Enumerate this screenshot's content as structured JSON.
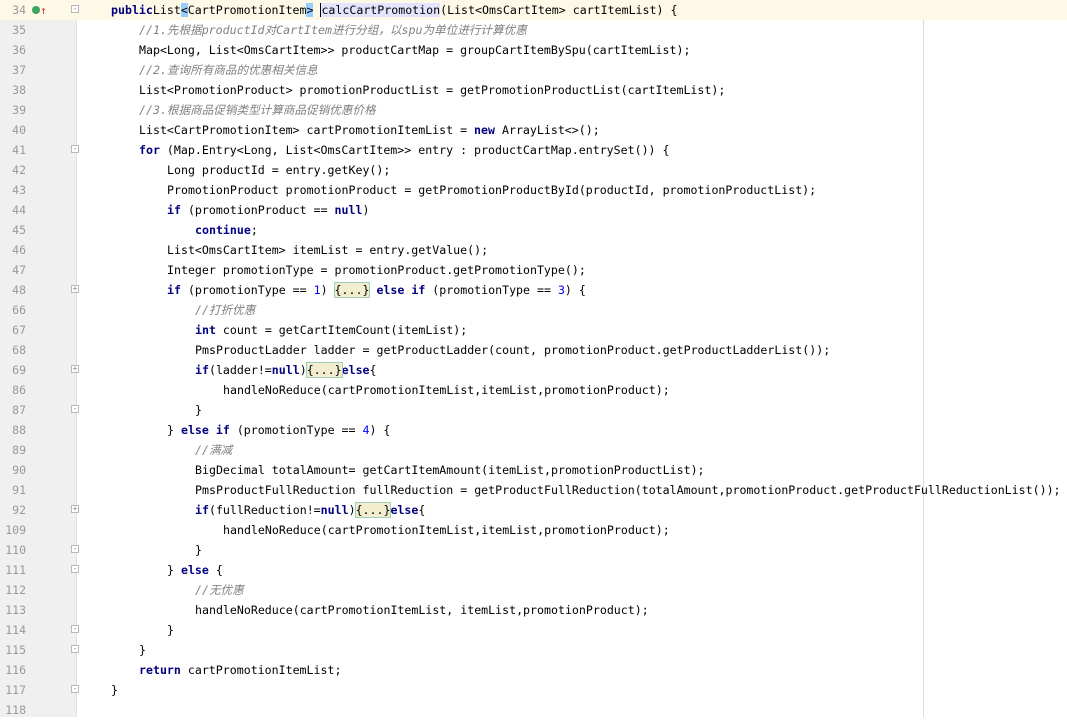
{
  "editor": {
    "colors": {
      "keyword": "#000080",
      "number": "#0000ff",
      "comment": "#808080",
      "current_line": "#fdf9e6"
    },
    "gutter_markers": {
      "34": [
        "implementing-method-icon",
        "overrides-up-arrow-icon"
      ]
    },
    "folds": {
      "34": "-",
      "41": "-",
      "48": "+",
      "69": "+",
      "87": "-",
      "92": "+",
      "110": "-",
      "111": "-",
      "114": "-",
      "115": "-",
      "117": "-"
    },
    "current_line": "34",
    "lines": [
      {
        "num": "34",
        "indent": 1,
        "tokens": [
          [
            "k",
            "public"
          ],
          [
            "",
            "List"
          ],
          [
            "b",
            "<"
          ],
          [
            "",
            "CartPromotionItem"
          ],
          [
            "b",
            ">"
          ],
          [
            "",
            " "
          ],
          [
            "h",
            "calcCartPromotion"
          ],
          [
            "",
            "(List<OmsCartItem> cartItemList) {"
          ]
        ]
      },
      {
        "num": "35",
        "indent": 2,
        "tokens": [
          [
            "c",
            "//1.先根据productId对CartItem进行分组，以spu为单位进行计算优惠"
          ]
        ]
      },
      {
        "num": "36",
        "indent": 2,
        "tokens": [
          [
            "",
            "Map<Long, List<OmsCartItem>> productCartMap = groupCartItemBySpu(cartItemList);"
          ]
        ]
      },
      {
        "num": "37",
        "indent": 2,
        "tokens": [
          [
            "c",
            "//2.查询所有商品的优惠相关信息"
          ]
        ]
      },
      {
        "num": "38",
        "indent": 2,
        "tokens": [
          [
            "",
            "List<PromotionProduct> promotionProductList = getPromotionProductList(cartItemList);"
          ]
        ]
      },
      {
        "num": "39",
        "indent": 2,
        "tokens": [
          [
            "c",
            "//3.根据商品促销类型计算商品促销优惠价格"
          ]
        ]
      },
      {
        "num": "40",
        "indent": 2,
        "tokens": [
          [
            "",
            "List<CartPromotionItem> cartPromotionItemList = "
          ],
          [
            "k",
            "new"
          ],
          [
            "",
            " ArrayList<>();"
          ]
        ]
      },
      {
        "num": "41",
        "indent": 2,
        "tokens": [
          [
            "k",
            "for"
          ],
          [
            "",
            " (Map.Entry<Long, List<OmsCartItem>> entry : productCartMap.entrySet()) {"
          ]
        ]
      },
      {
        "num": "42",
        "indent": 3,
        "tokens": [
          [
            "",
            "Long productId = entry.getKey();"
          ]
        ]
      },
      {
        "num": "43",
        "indent": 3,
        "tokens": [
          [
            "",
            "PromotionProduct promotionProduct = getPromotionProductById(productId, promotionProductList);"
          ]
        ]
      },
      {
        "num": "44",
        "indent": 3,
        "tokens": [
          [
            "k",
            "if"
          ],
          [
            "",
            " (promotionProduct == "
          ],
          [
            "k",
            "null"
          ],
          [
            "",
            ")"
          ]
        ]
      },
      {
        "num": "45",
        "indent": 4,
        "tokens": [
          [
            "k",
            "continue"
          ],
          [
            "",
            ";"
          ]
        ]
      },
      {
        "num": "46",
        "indent": 3,
        "tokens": [
          [
            "",
            "List<OmsCartItem> itemList = entry.getValue();"
          ]
        ]
      },
      {
        "num": "47",
        "indent": 3,
        "tokens": [
          [
            "",
            "Integer promotionType = promotionProduct.getPromotionType();"
          ]
        ]
      },
      {
        "num": "48",
        "indent": 3,
        "tokens": [
          [
            "k",
            "if"
          ],
          [
            "",
            " (promotionType == "
          ],
          [
            "n",
            "1"
          ],
          [
            "",
            ") "
          ],
          [
            "f",
            "{...}"
          ],
          [
            "",
            " "
          ],
          [
            "k",
            "else"
          ],
          [
            "",
            " "
          ],
          [
            "k",
            "if"
          ],
          [
            "",
            " (promotionType == "
          ],
          [
            "n",
            "3"
          ],
          [
            "",
            ") {"
          ]
        ]
      },
      {
        "num": "66",
        "indent": 4,
        "tokens": [
          [
            "c",
            "//打折优惠"
          ]
        ]
      },
      {
        "num": "67",
        "indent": 4,
        "tokens": [
          [
            "k",
            "int"
          ],
          [
            "",
            " count = getCartItemCount(itemList);"
          ]
        ]
      },
      {
        "num": "68",
        "indent": 4,
        "tokens": [
          [
            "",
            "PmsProductLadder ladder = getProductLadder(count, promotionProduct.getProductLadderList());"
          ]
        ]
      },
      {
        "num": "69",
        "indent": 4,
        "tokens": [
          [
            "k",
            "if"
          ],
          [
            "",
            "(ladder!="
          ],
          [
            "k",
            "null"
          ],
          [
            "",
            ")"
          ],
          [
            "f",
            "{...}"
          ],
          [
            "k",
            "else"
          ],
          [
            "",
            "{"
          ]
        ]
      },
      {
        "num": "86",
        "indent": 5,
        "tokens": [
          [
            "",
            "handleNoReduce(cartPromotionItemList,itemList,promotionProduct);"
          ]
        ]
      },
      {
        "num": "87",
        "indent": 4,
        "tokens": [
          [
            "",
            "}"
          ]
        ]
      },
      {
        "num": "88",
        "indent": 3,
        "tokens": [
          [
            "",
            "} "
          ],
          [
            "k",
            "else"
          ],
          [
            "",
            " "
          ],
          [
            "k",
            "if"
          ],
          [
            "",
            " (promotionType == "
          ],
          [
            "n",
            "4"
          ],
          [
            "",
            ") {"
          ]
        ]
      },
      {
        "num": "89",
        "indent": 4,
        "tokens": [
          [
            "c",
            "//满减"
          ]
        ]
      },
      {
        "num": "90",
        "indent": 4,
        "tokens": [
          [
            "",
            "BigDecimal totalAmount= getCartItemAmount(itemList,promotionProductList);"
          ]
        ]
      },
      {
        "num": "91",
        "indent": 4,
        "tokens": [
          [
            "",
            "PmsProductFullReduction fullReduction = getProductFullReduction(totalAmount,promotionProduct.getProductFullReductionList());"
          ]
        ]
      },
      {
        "num": "92",
        "indent": 4,
        "tokens": [
          [
            "k",
            "if"
          ],
          [
            "",
            "(fullReduction!="
          ],
          [
            "k",
            "null"
          ],
          [
            "",
            ")"
          ],
          [
            "f",
            "{...}"
          ],
          [
            "k",
            "else"
          ],
          [
            "",
            "{"
          ]
        ]
      },
      {
        "num": "109",
        "indent": 5,
        "tokens": [
          [
            "",
            "handleNoReduce(cartPromotionItemList,itemList,promotionProduct);"
          ]
        ]
      },
      {
        "num": "110",
        "indent": 4,
        "tokens": [
          [
            "",
            "}"
          ]
        ]
      },
      {
        "num": "111",
        "indent": 3,
        "tokens": [
          [
            "",
            "} "
          ],
          [
            "k",
            "else"
          ],
          [
            "",
            " {"
          ]
        ]
      },
      {
        "num": "112",
        "indent": 4,
        "tokens": [
          [
            "c",
            "//无优惠"
          ]
        ]
      },
      {
        "num": "113",
        "indent": 4,
        "tokens": [
          [
            "",
            "handleNoReduce(cartPromotionItemList, itemList,promotionProduct);"
          ]
        ]
      },
      {
        "num": "114",
        "indent": 3,
        "tokens": [
          [
            "",
            "}"
          ]
        ]
      },
      {
        "num": "115",
        "indent": 2,
        "tokens": [
          [
            "",
            "}"
          ]
        ]
      },
      {
        "num": "116",
        "indent": 2,
        "tokens": [
          [
            "k",
            "return"
          ],
          [
            "",
            " cartPromotionItemList;"
          ]
        ]
      },
      {
        "num": "117",
        "indent": 1,
        "tokens": [
          [
            "",
            "}"
          ]
        ]
      },
      {
        "num": "118",
        "indent": 0,
        "tokens": []
      }
    ]
  }
}
